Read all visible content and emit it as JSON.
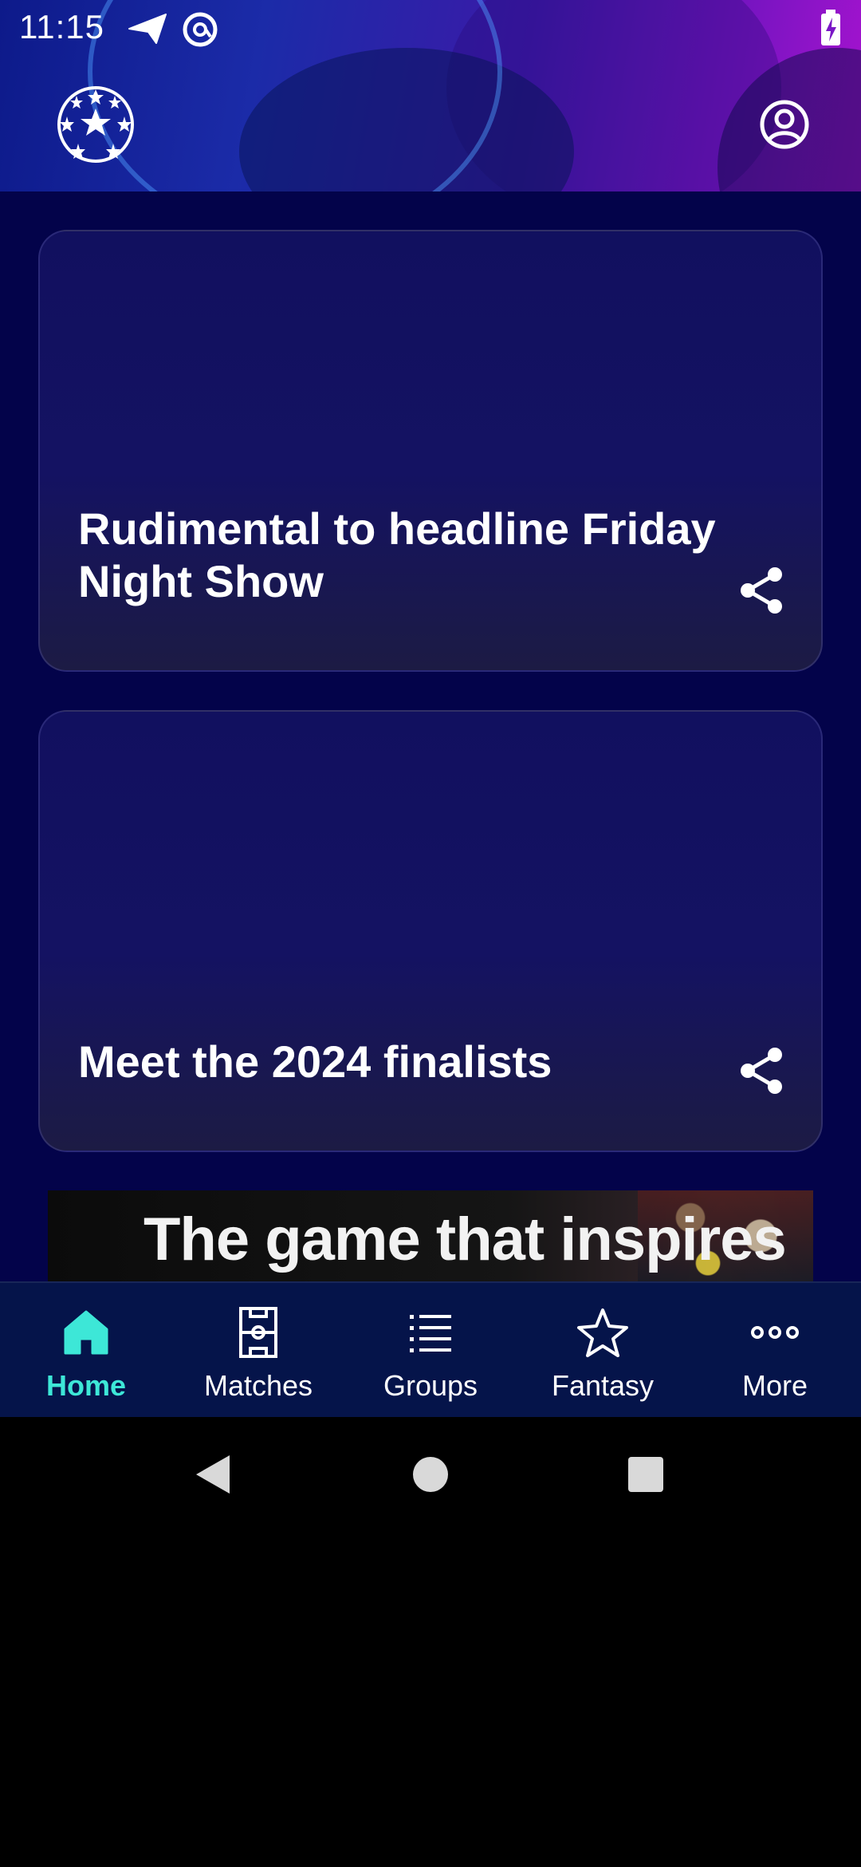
{
  "status_bar": {
    "time": "11:15",
    "icons": [
      "send-icon",
      "at-sign-icon",
      "battery-charging-icon"
    ]
  },
  "header": {
    "logo": "starball-logo",
    "profile_icon": "account-circle-icon"
  },
  "cards": [
    {
      "title": "Rudimental to headline Friday Night Show",
      "action_icon": "share-icon"
    },
    {
      "title": "Meet the 2024 finalists",
      "action_icon": "share-icon"
    }
  ],
  "banner": {
    "text": "The game that inspires"
  },
  "bottom_nav": {
    "items": [
      {
        "label": "Home",
        "icon": "home-icon",
        "active": true
      },
      {
        "label": "Matches",
        "icon": "pitch-icon",
        "active": false
      },
      {
        "label": "Groups",
        "icon": "list-icon",
        "active": false
      },
      {
        "label": "Fantasy",
        "icon": "star-icon",
        "active": false
      },
      {
        "label": "More",
        "icon": "more-dots-icon",
        "active": false
      }
    ],
    "active_color": "#3de7d7"
  },
  "system_nav": [
    "back-icon",
    "home-circle-icon",
    "recents-icon"
  ],
  "colors": {
    "background": "#03034a",
    "card": "#11105f",
    "nav": "#05144a"
  }
}
